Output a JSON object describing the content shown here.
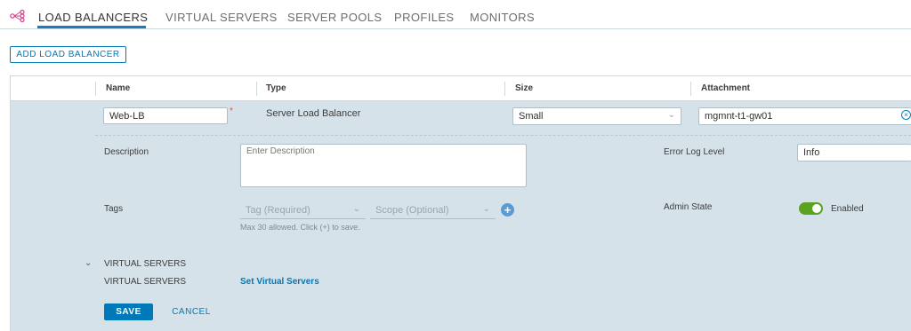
{
  "tabs": [
    "LOAD BALANCERS",
    "VIRTUAL SERVERS",
    "SERVER POOLS",
    "PROFILES",
    "MONITORS"
  ],
  "toolbar": {
    "add_label": "ADD LOAD BALANCER"
  },
  "table": {
    "columns": [
      "Name",
      "Type",
      "Size",
      "Attachment"
    ]
  },
  "form": {
    "name_value": "Web-LB",
    "required_mark": "*",
    "type_value": "Server Load Balancer",
    "size_value": "Small",
    "attachment_value": "mgmnt-t1-gw01",
    "description_label": "Description",
    "description_placeholder": "Enter Description",
    "error_log_label": "Error Log Level",
    "error_log_value": "Info",
    "tags_label": "Tags",
    "tag_placeholder": "Tag (Required)",
    "scope_placeholder": "Scope (Optional)",
    "tags_hint": "Max 30 allowed. Click (+) to save.",
    "admin_state_label": "Admin State",
    "admin_state_value": "Enabled",
    "admin_state_on": true
  },
  "virtual_servers": {
    "section_title": "VIRTUAL SERVERS",
    "row_label": "VIRTUAL SERVERS",
    "link_label": "Set Virtual Servers"
  },
  "actions": {
    "save_label": "SAVE",
    "cancel_label": "CANCEL"
  },
  "colors": {
    "accent": "#0079b8",
    "toggle_on": "#5aa220",
    "form_bg": "#d6e2ea",
    "required": "#d9544f"
  }
}
